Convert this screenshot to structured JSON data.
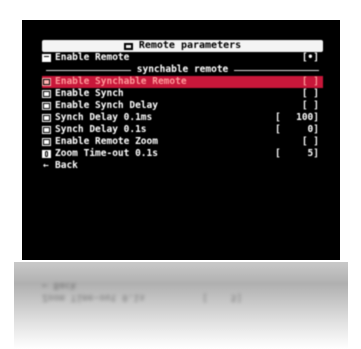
{
  "menu": {
    "title": "Remote parameters",
    "items": [
      {
        "icon": "remote-icon",
        "label": "Enable Remote",
        "value": "[•]"
      },
      {
        "separator": true,
        "label": "synchable remote"
      },
      {
        "icon": "checkbox-icon",
        "label": "Enable Synchable Remote",
        "value": "[ ]",
        "selected": true
      },
      {
        "icon": "checkbox-icon",
        "label": "Enable Synch",
        "value": "[ ]"
      },
      {
        "icon": "checkbox-icon",
        "label": "Enable Synch Delay",
        "value": "[ ]"
      },
      {
        "icon": "checkbox-icon",
        "label": "Synch Delay 0.1ms",
        "open": "[",
        "value": "100]"
      },
      {
        "icon": "checkbox-icon",
        "label": "Synch Delay 0.1s",
        "open": "[",
        "value": "0]"
      },
      {
        "icon": "checkbox-icon",
        "label": "Enable Remote Zoom",
        "value": "[ ]"
      },
      {
        "icon": "timer-icon",
        "label": "Zoom Time-out 0.1s",
        "open": "[",
        "value": "5]"
      },
      {
        "icon": "back-arrow-icon",
        "label": "Back"
      }
    ]
  },
  "reflection": {
    "row1": "← Back",
    "row2": "Zoom Time-out 0.1s          [    5]"
  },
  "colors": {
    "selected_bg": "#c8173a",
    "selected_fg": "#ff9a9a",
    "screen_bg": "#000000",
    "title_bg": "#f4f4f4"
  }
}
